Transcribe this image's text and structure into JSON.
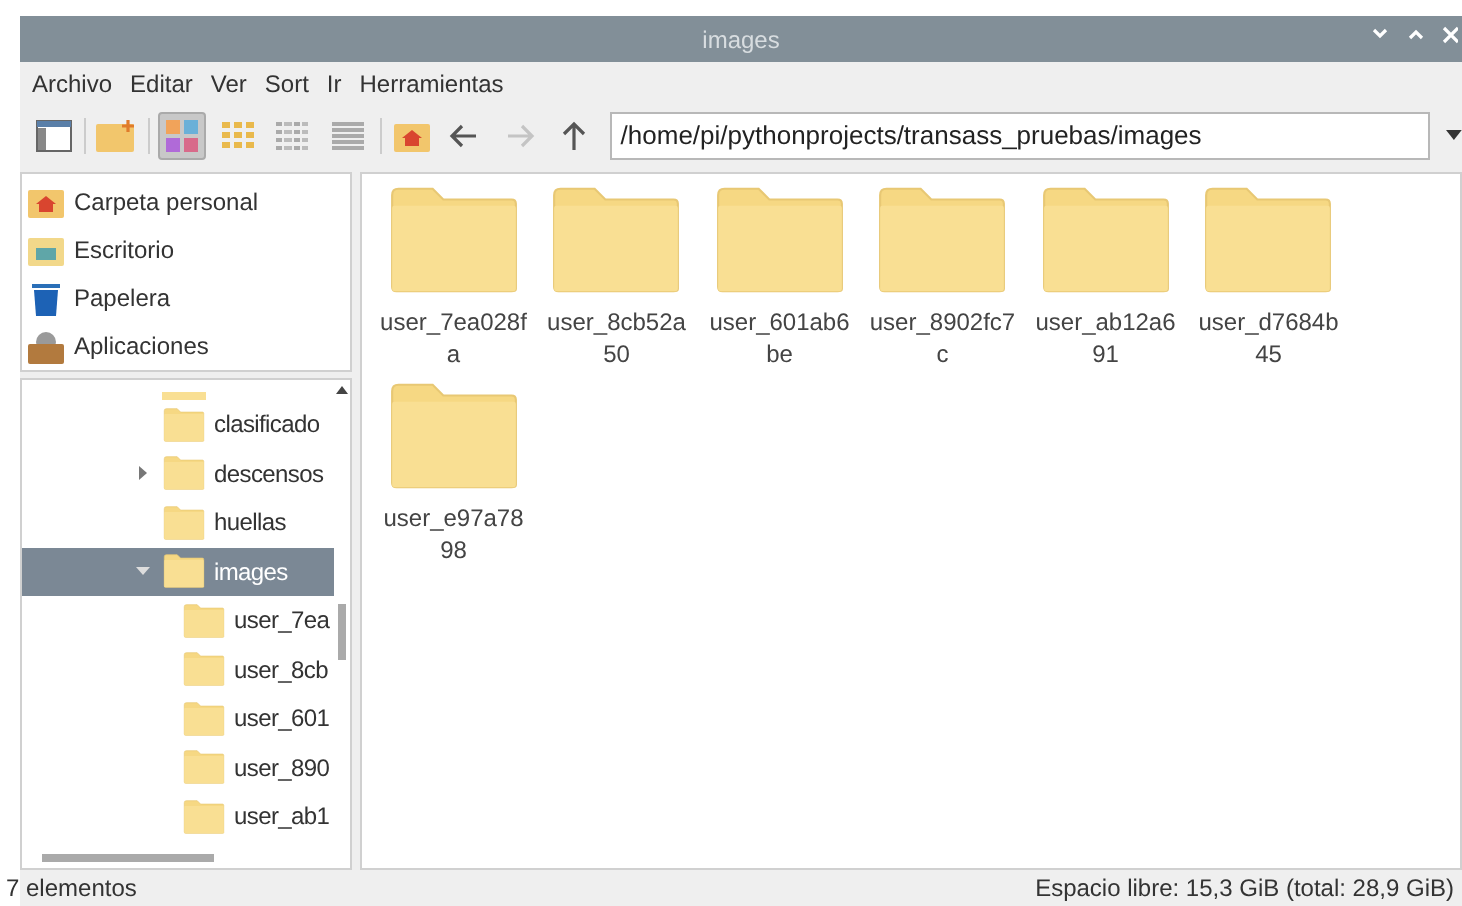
{
  "window": {
    "title": "images"
  },
  "menu": [
    "Archivo",
    "Editar",
    "Ver",
    "Sort",
    "Ir",
    "Herramientas"
  ],
  "toolbar": {
    "view_modes": [
      {
        "kind": "icons",
        "selected": true
      },
      {
        "kind": "thumbnails",
        "selected": false
      },
      {
        "kind": "compact",
        "selected": false
      },
      {
        "kind": "list",
        "selected": false
      }
    ],
    "nav": [
      {
        "kind": "back",
        "disabled": false
      },
      {
        "kind": "forward",
        "disabled": true
      },
      {
        "kind": "up",
        "disabled": false
      }
    ],
    "path": "/home/pi/pythonprojects/transass_pruebas/images"
  },
  "places": [
    {
      "kind": "home",
      "label": "Carpeta personal"
    },
    {
      "kind": "desktop",
      "label": "Escritorio"
    },
    {
      "kind": "trash",
      "label": "Papelera"
    },
    {
      "kind": "apps",
      "label": "Aplicaciones"
    }
  ],
  "tree": [
    {
      "label": "clasificado",
      "selected": false
    },
    {
      "label": "descensos",
      "expanded": false,
      "selected": false
    },
    {
      "label": "huellas",
      "selected": false
    },
    {
      "label": "images",
      "expanded": true,
      "selected": true,
      "children": [
        {
          "label": "user_7ea",
          "selected": false
        },
        {
          "label": "user_8cb",
          "selected": false
        },
        {
          "label": "user_601",
          "selected": false
        },
        {
          "label": "user_890",
          "selected": false
        },
        {
          "label": "user_ab1",
          "selected": false
        }
      ]
    }
  ],
  "files": [
    {
      "name": "user_7ea028f a"
    },
    {
      "name": "user_8cb52a 50"
    },
    {
      "name": "user_601ab6 be"
    },
    {
      "name": "user_8902fc7 c"
    },
    {
      "name": "user_ab12a6 91"
    },
    {
      "name": "user_d7684b 45"
    },
    {
      "name": "user_e97a78 98"
    }
  ],
  "status_bar": {
    "count": "7 elementos",
    "free_space": "Espacio libre: 15,3 GiB (total: 28,9 GiB)"
  }
}
